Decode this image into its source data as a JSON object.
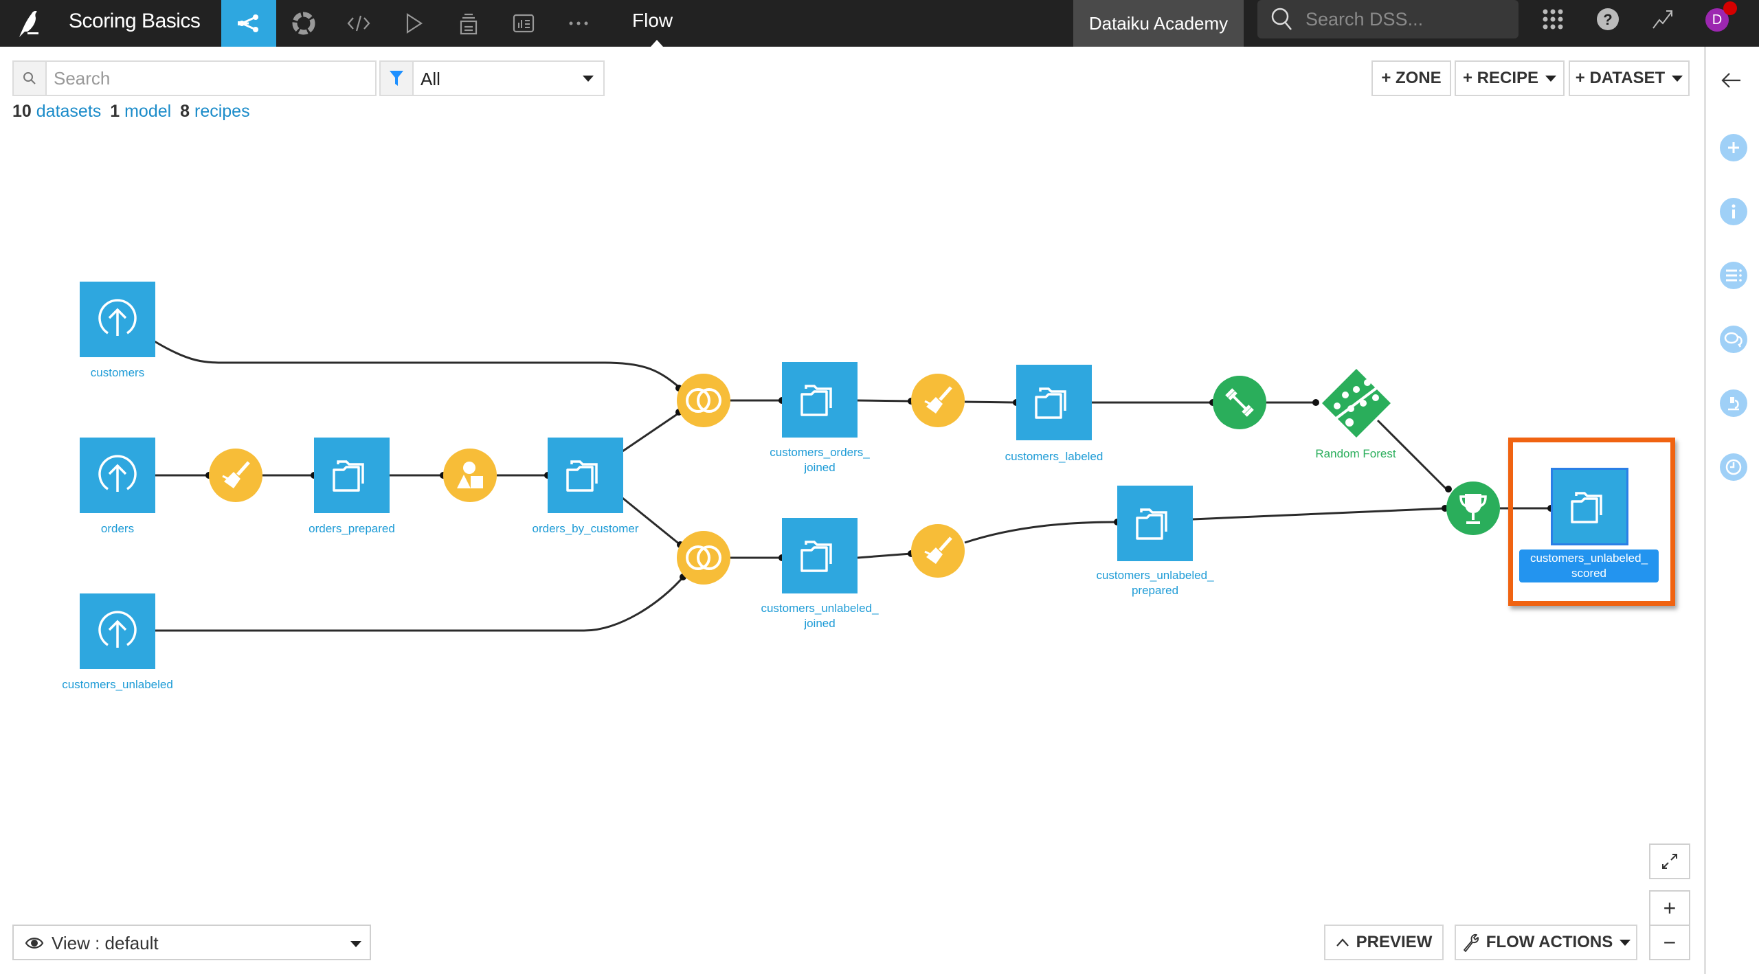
{
  "topbar": {
    "project_title": "Scoring Basics",
    "nav_icons": [
      "flow-icon",
      "lab-icon",
      "code-icon",
      "jobs-icon",
      "deploy-icon",
      "dashboard-icon",
      "more-icon"
    ],
    "current_section": "Flow",
    "instance_name": "Dataiku Academy",
    "search_placeholder": "Search DSS...",
    "avatar_initial": "D"
  },
  "toolbar": {
    "search_placeholder": "Search",
    "filter_value": "All",
    "summary": {
      "datasets_count": "10",
      "datasets_label": "datasets",
      "models_count": "1",
      "models_label": "model",
      "recipes_count": "8",
      "recipes_label": "recipes"
    },
    "add_zone": "+ ZONE",
    "add_recipe": "+ RECIPE",
    "add_dataset": "+ DATASET"
  },
  "flow": {
    "datasets": [
      {
        "id": "customers",
        "label": "customers",
        "type": "upload"
      },
      {
        "id": "orders",
        "label": "orders",
        "type": "upload"
      },
      {
        "id": "customers_unlabeled",
        "label": "customers_unlabeled",
        "type": "upload"
      },
      {
        "id": "orders_prepared",
        "label": "orders_prepared",
        "type": "managed"
      },
      {
        "id": "orders_by_customer",
        "label": "orders_by_customer",
        "type": "managed"
      },
      {
        "id": "customers_orders_joined",
        "label": "customers_orders_\njoined",
        "type": "managed"
      },
      {
        "id": "customers_labeled",
        "label": "customers_labeled",
        "type": "managed"
      },
      {
        "id": "customers_unlabeled_joined",
        "label": "customers_unlabeled_\njoined",
        "type": "managed"
      },
      {
        "id": "customers_unlabeled_prepared",
        "label": "customers_unlabeled_\nprepared",
        "type": "managed"
      },
      {
        "id": "customers_unlabeled_scored",
        "label": "customers_unlabeled_\nscored",
        "type": "managed",
        "selected": true
      }
    ],
    "recipes": [
      {
        "id": "prepare_orders",
        "type": "prepare"
      },
      {
        "id": "group_orders",
        "type": "group"
      },
      {
        "id": "join_customers_orders",
        "type": "join"
      },
      {
        "id": "join_customers_unlabeled",
        "type": "join"
      },
      {
        "id": "prepare_labeled",
        "type": "prepare"
      },
      {
        "id": "prepare_unlabeled",
        "type": "prepare"
      },
      {
        "id": "train_model",
        "type": "train"
      },
      {
        "id": "score_model",
        "type": "score"
      }
    ],
    "models": [
      {
        "id": "random_forest",
        "label": "Random Forest"
      }
    ],
    "colors": {
      "dataset": "#2ea7df",
      "visual_recipe": "#f7bd38",
      "ml": "#2aae5b",
      "highlight": "#f06311"
    }
  },
  "bottom": {
    "view_label": "View : default",
    "preview_label": "PREVIEW",
    "flow_actions_label": "FLOW ACTIONS",
    "zoom_in": "+",
    "zoom_out": "−"
  },
  "right_panel": {
    "icons": [
      "back-arrow-icon",
      "add-icon",
      "info-icon",
      "details-icon",
      "discussions-icon",
      "lab-icon",
      "timeline-icon"
    ]
  }
}
